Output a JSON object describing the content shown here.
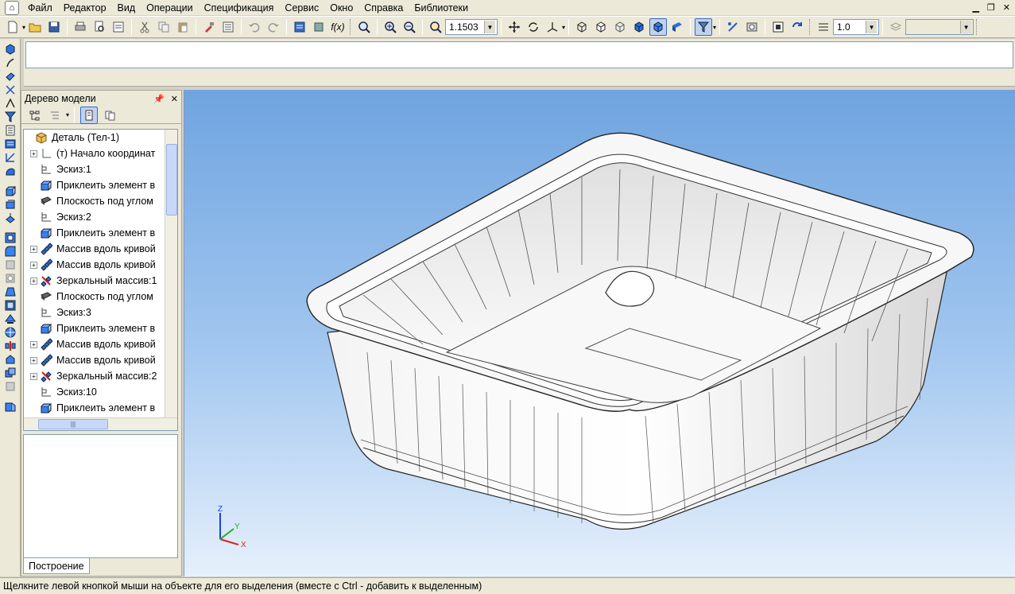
{
  "menu": {
    "items": [
      "Файл",
      "Редактор",
      "Вид",
      "Операции",
      "Спецификация",
      "Сервис",
      "Окно",
      "Справка",
      "Библиотеки"
    ]
  },
  "toolbar": {
    "zoom_value": "1.1503",
    "line_scale_value": "1.0",
    "layer_value": ""
  },
  "tree_panel": {
    "title": "Дерево модели",
    "root": "Деталь (Тел-1)",
    "items": [
      {
        "label": "(т) Начало координат",
        "expandable": true,
        "icon": "origin-icon"
      },
      {
        "label": "Эскиз:1",
        "expandable": false,
        "icon": "sketch-icon"
      },
      {
        "label": "Приклеить элемент в",
        "expandable": false,
        "icon": "extrude-icon"
      },
      {
        "label": "Плоскость под углом",
        "expandable": false,
        "icon": "plane-icon"
      },
      {
        "label": "Эскиз:2",
        "expandable": false,
        "icon": "sketch-icon"
      },
      {
        "label": "Приклеить элемент в",
        "expandable": false,
        "icon": "extrude-icon"
      },
      {
        "label": "Массив вдоль кривой",
        "expandable": true,
        "icon": "array-icon"
      },
      {
        "label": "Массив вдоль кривой",
        "expandable": true,
        "icon": "array-icon"
      },
      {
        "label": "Зеркальный массив:1",
        "expandable": true,
        "icon": "mirror-icon"
      },
      {
        "label": "Плоскость под углом",
        "expandable": false,
        "icon": "plane-icon"
      },
      {
        "label": "Эскиз:3",
        "expandable": false,
        "icon": "sketch-icon"
      },
      {
        "label": "Приклеить элемент в",
        "expandable": false,
        "icon": "extrude-icon"
      },
      {
        "label": "Массив вдоль кривой",
        "expandable": true,
        "icon": "array-icon"
      },
      {
        "label": "Массив вдоль кривой",
        "expandable": true,
        "icon": "array-icon"
      },
      {
        "label": "Зеркальный массив:2",
        "expandable": true,
        "icon": "mirror-icon"
      },
      {
        "label": "Эскиз:10",
        "expandable": false,
        "icon": "sketch-icon"
      },
      {
        "label": "Приклеить элемент в",
        "expandable": false,
        "icon": "extrude-icon"
      }
    ],
    "tab_label": "Построение"
  },
  "axes": {
    "x": "X",
    "y": "Y",
    "z": "Z"
  },
  "colors": {
    "viewport_top": "#6fa4e0",
    "viewport_bottom": "#e6f0fb",
    "axis_x": "#e02020",
    "axis_y": "#20b020",
    "axis_z": "#2040e0"
  },
  "status": {
    "text": "Щелкните левой кнопкой мыши на объекте для его выделения (вместе с Ctrl - добавить к выделенным)"
  }
}
